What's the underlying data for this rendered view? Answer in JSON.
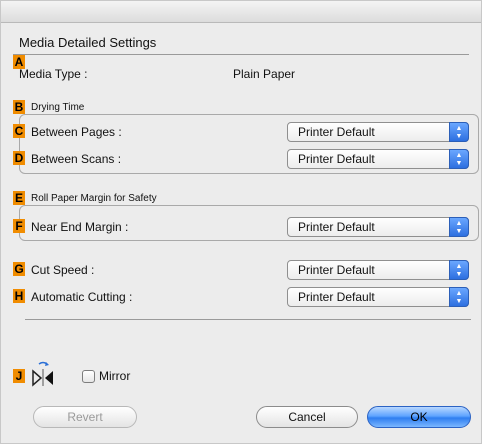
{
  "dialog": {
    "section_title": "Media Detailed Settings"
  },
  "badges": {
    "A": "A",
    "B": "B",
    "C": "C",
    "D": "D",
    "E": "E",
    "F": "F",
    "G": "G",
    "H": "H",
    "J": "J"
  },
  "media_type": {
    "label": "Media Type :",
    "value": "Plain Paper"
  },
  "drying_time": {
    "group_label": "Drying Time",
    "between_pages": {
      "label": "Between Pages :",
      "value": "Printer Default"
    },
    "between_scans": {
      "label": "Between Scans :",
      "value": "Printer Default"
    }
  },
  "roll_margin": {
    "group_label": "Roll Paper Margin for Safety",
    "near_end_margin": {
      "label": "Near End Margin :",
      "value": "Printer Default"
    }
  },
  "cut_speed": {
    "label": "Cut Speed :",
    "value": "Printer Default"
  },
  "automatic_cutting": {
    "label": "Automatic Cutting :",
    "value": "Printer Default"
  },
  "mirror": {
    "label": "Mirror",
    "checked": false
  },
  "buttons": {
    "revert": "Revert",
    "cancel": "Cancel",
    "ok": "OK"
  },
  "colors": {
    "badge": "#f08c00",
    "default_button": "#2f7ef0",
    "popup_arrows": "#2d6fe0"
  },
  "icons": {
    "popup_arrows": "up-down-arrows-icon",
    "mirror_orientation": "mirror-orientation-icon"
  }
}
